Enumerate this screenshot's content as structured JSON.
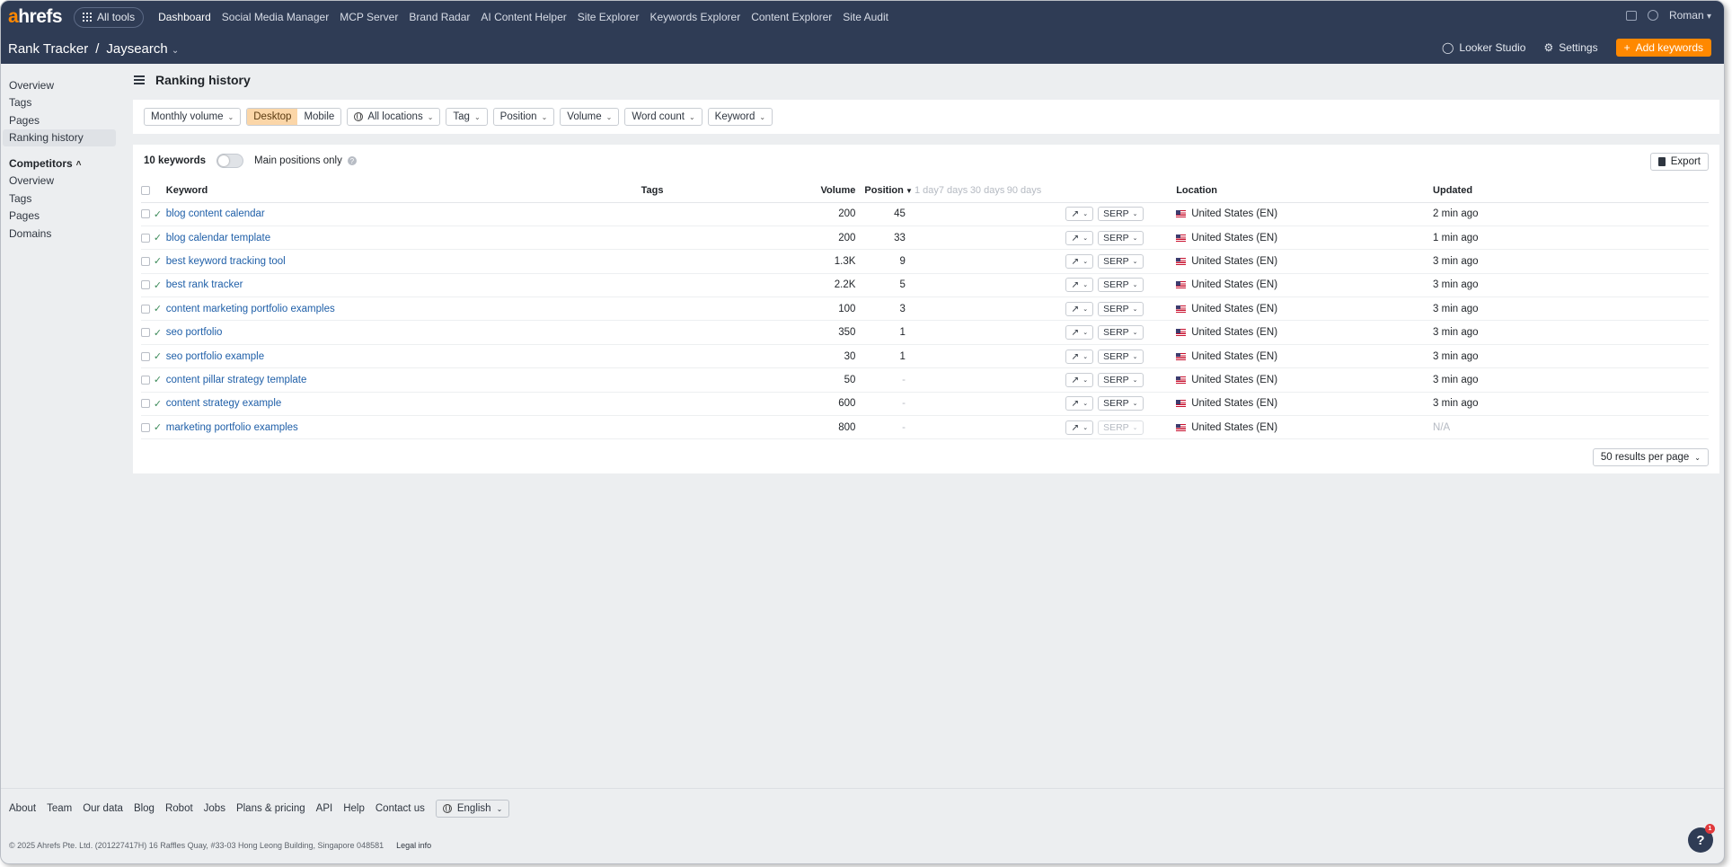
{
  "topnav": {
    "logo_a": "a",
    "logo_rest": "hrefs",
    "all_tools": "All tools",
    "items": [
      "Dashboard",
      "Social Media Manager",
      "MCP Server",
      "Brand Radar",
      "AI Content Helper",
      "Site Explorer",
      "Keywords Explorer",
      "Content Explorer",
      "Site Audit"
    ],
    "user": "Roman"
  },
  "subbar": {
    "tool": "Rank Tracker",
    "separator": "/",
    "project": "Jaysearch",
    "looker": "Looker Studio",
    "settings": "Settings",
    "add_keywords": "Add keywords"
  },
  "sidebar": {
    "items": [
      "Overview",
      "Tags",
      "Pages",
      "Ranking history"
    ],
    "competitors_label": "Competitors",
    "competitor_items": [
      "Overview",
      "Tags",
      "Pages",
      "Domains"
    ]
  },
  "page": {
    "title": "Ranking history"
  },
  "filters": {
    "monthly_volume": "Monthly volume",
    "desktop": "Desktop",
    "mobile": "Mobile",
    "locations": "All locations",
    "tag": "Tag",
    "position": "Position",
    "volume": "Volume",
    "word_count": "Word count",
    "keyword": "Keyword"
  },
  "table": {
    "count_label": "10 keywords",
    "main_positions": "Main positions only",
    "export": "Export",
    "headers": {
      "keyword": "Keyword",
      "tags": "Tags",
      "volume": "Volume",
      "position": "Position",
      "d1": "1 day",
      "d7": "7 days",
      "d30": "30 days",
      "d90": "90 days",
      "location": "Location",
      "updated": "Updated"
    },
    "serp_label": "SERP",
    "rows": [
      {
        "keyword": "blog content calendar",
        "volume": "200",
        "position": "45",
        "location": "United States (EN)",
        "updated": "2 min ago",
        "serp_enabled": true
      },
      {
        "keyword": "blog calendar template",
        "volume": "200",
        "position": "33",
        "location": "United States (EN)",
        "updated": "1 min ago",
        "serp_enabled": true
      },
      {
        "keyword": "best keyword tracking tool",
        "volume": "1.3K",
        "position": "9",
        "location": "United States (EN)",
        "updated": "3 min ago",
        "serp_enabled": true
      },
      {
        "keyword": "best rank tracker",
        "volume": "2.2K",
        "position": "5",
        "location": "United States (EN)",
        "updated": "3 min ago",
        "serp_enabled": true
      },
      {
        "keyword": "content marketing portfolio examples",
        "volume": "100",
        "position": "3",
        "location": "United States (EN)",
        "updated": "3 min ago",
        "serp_enabled": true
      },
      {
        "keyword": "seo portfolio",
        "volume": "350",
        "position": "1",
        "location": "United States (EN)",
        "updated": "3 min ago",
        "serp_enabled": true
      },
      {
        "keyword": "seo portfolio example",
        "volume": "30",
        "position": "1",
        "location": "United States (EN)",
        "updated": "3 min ago",
        "serp_enabled": true
      },
      {
        "keyword": "content pillar strategy template",
        "volume": "50",
        "position": "-",
        "location": "United States (EN)",
        "updated": "3 min ago",
        "serp_enabled": true
      },
      {
        "keyword": "content strategy example",
        "volume": "600",
        "position": "-",
        "location": "United States (EN)",
        "updated": "3 min ago",
        "serp_enabled": true
      },
      {
        "keyword": "marketing portfolio examples",
        "volume": "800",
        "position": "-",
        "location": "United States (EN)",
        "updated": "N/A",
        "serp_enabled": false
      }
    ],
    "results_per_page": "50 results per page"
  },
  "footer": {
    "links": [
      "About",
      "Team",
      "Our data",
      "Blog",
      "Robot",
      "Jobs",
      "Plans & pricing",
      "API",
      "Help",
      "Contact us"
    ],
    "language": "English",
    "copyright": "© 2025 Ahrefs Pte. Ltd. (201227417H) 16 Raffles Quay, #33-03 Hong Leong Building, Singapore 048581",
    "legal": "Legal info",
    "help_label": "?",
    "help_badge": "1"
  },
  "colors": {
    "topbar": "#2f3c55",
    "accent": "#ff8800",
    "link": "#1f5fa8",
    "segment_on": "#fbd6a8"
  }
}
